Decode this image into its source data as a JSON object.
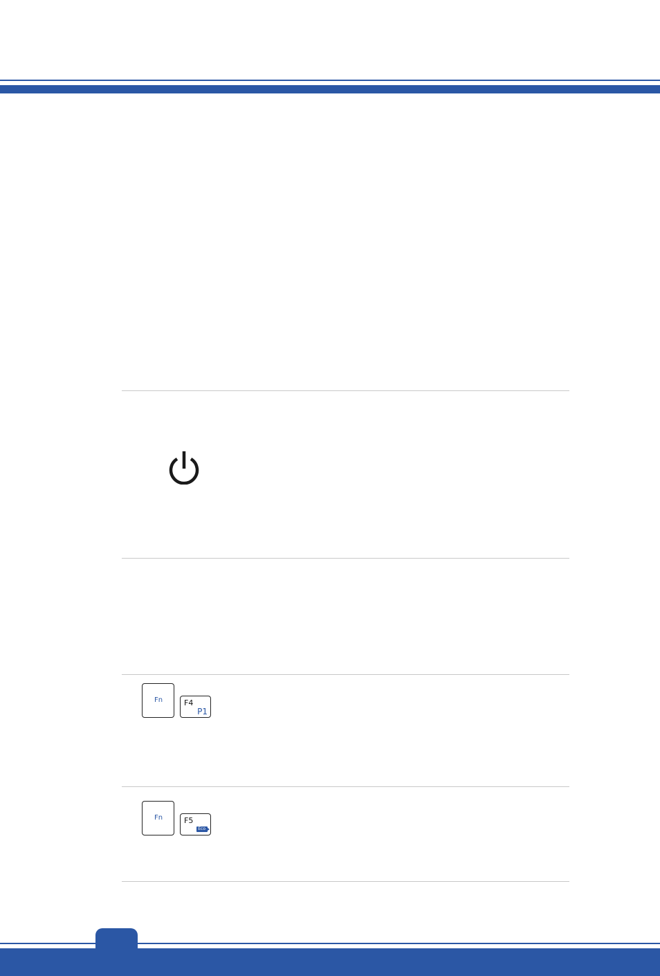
{
  "header": {
    "band_color": "#2b57a5"
  },
  "power_row": {
    "icon": "power-icon"
  },
  "hotkeys": [
    {
      "modifier_label": "Fn",
      "key_label": "F4",
      "key_secondary": "P1"
    },
    {
      "modifier_label": "Fn",
      "key_label": "F5",
      "key_badge": "Eco"
    }
  ],
  "footer": {
    "page_number": "",
    "band_color": "#2b57a5"
  }
}
